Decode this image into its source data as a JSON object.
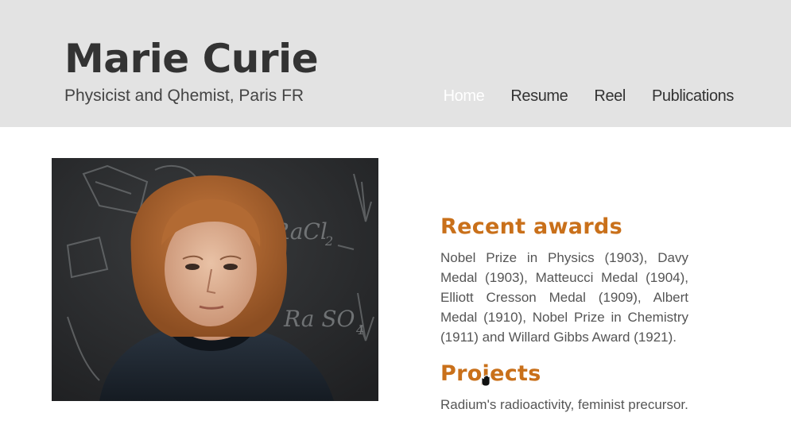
{
  "header": {
    "title": "Marie Curie",
    "subtitle": "Physicist and Qhemist, Paris FR"
  },
  "nav": {
    "items": [
      {
        "label": "Home",
        "active": true
      },
      {
        "label": "Resume",
        "active": false
      },
      {
        "label": "Reel",
        "active": false
      },
      {
        "label": "Publications",
        "active": false
      }
    ]
  },
  "photo": {
    "board_text_1": "RaCl",
    "board_text_1_sub": "2",
    "board_text_2": "Ra SO",
    "board_text_2_sub": "4"
  },
  "awards": {
    "heading": "Recent awards",
    "text": "Nobel Prize in Physics (1903), Davy Medal (1903), Matteucci Medal (1904), Elliott Cresson Medal (1909), Albert Medal (1910), Nobel Prize in Chemistry (1911) and Willard Gibbs Award (1921)."
  },
  "projects": {
    "heading": "Projects",
    "text": "Radium's radioactivity, feminist precursor."
  },
  "colors": {
    "header_bg": "#e3e3e3",
    "accent": "#c9701a",
    "title": "#333333",
    "nav_active": "#ffffff"
  },
  "cursor": {
    "icon": "grab-hand-icon"
  }
}
